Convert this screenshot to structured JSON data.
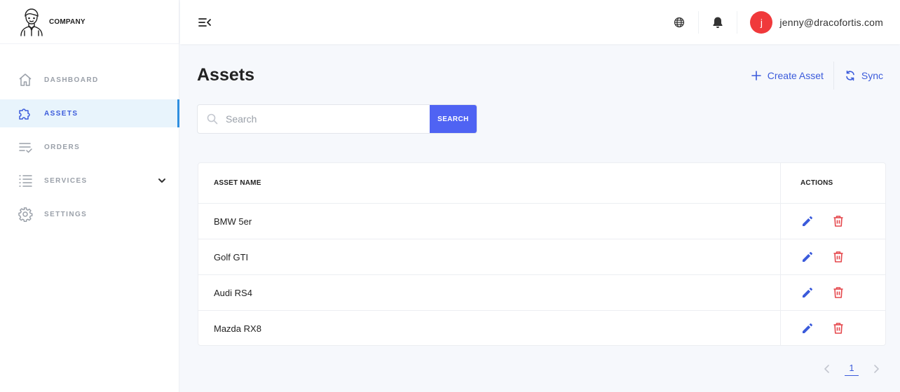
{
  "brand": {
    "name": "COMPANY",
    "logo_icon": "businessman-avatar-icon"
  },
  "sidebar": {
    "items": [
      {
        "label": "DASHBOARD",
        "icon": "home-icon",
        "active": false
      },
      {
        "label": "ASSETS",
        "icon": "puzzle-icon",
        "active": true
      },
      {
        "label": "ORDERS",
        "icon": "checklist-icon",
        "active": false
      },
      {
        "label": "SERVICES",
        "icon": "list-icon",
        "active": false,
        "expandable": true
      },
      {
        "label": "SETTINGS",
        "icon": "gear-icon",
        "active": false
      }
    ]
  },
  "topbar": {
    "menu_icon": "menu-collapse-icon",
    "language_icon": "globe-icon",
    "notification_icon": "bell-icon",
    "avatar_initial": "j",
    "user_email": "jenny@dracofortis.com"
  },
  "page": {
    "title": "Assets",
    "create_label": "Create Asset",
    "sync_label": "Sync"
  },
  "search": {
    "placeholder": "Search",
    "value": "",
    "button_label": "SEARCH"
  },
  "table": {
    "columns": [
      "ASSET NAME",
      "ACTIONS"
    ],
    "rows": [
      {
        "name": "BMW 5er"
      },
      {
        "name": "Golf GTI"
      },
      {
        "name": "Audi RS4"
      },
      {
        "name": "Mazda RX8"
      }
    ]
  },
  "pagination": {
    "current_page": "1"
  },
  "colors": {
    "accent": "#3b5bdb",
    "search_button": "#4f63f3",
    "active_bg": "#e8f4fc",
    "active_bar": "#2f8fe0",
    "avatar": "#f0393b",
    "delete": "#e5484d"
  }
}
